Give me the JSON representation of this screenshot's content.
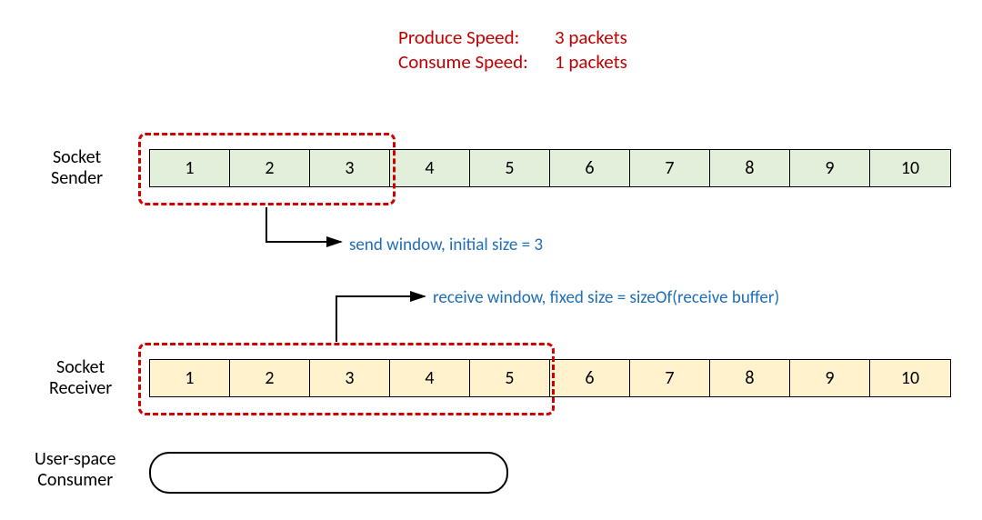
{
  "speeds": {
    "produce_label": "Produce Speed:",
    "produce_value": "3 packets",
    "consume_label": "Consume Speed:",
    "consume_value": "1 packets"
  },
  "labels": {
    "sender_l1": "Socket",
    "sender_l2": "Sender",
    "receiver_l1": "Socket",
    "receiver_l2": "Receiver",
    "consumer_l1": "User-space",
    "consumer_l2": "Consumer"
  },
  "annotations": {
    "send_window": "send window, initial size = 3",
    "receive_window": "receive window,  fixed size = sizeOf(receive buffer)"
  },
  "chart_data": {
    "type": "table",
    "sender_buffer": [
      "1",
      "2",
      "3",
      "4",
      "5",
      "6",
      "7",
      "8",
      "9",
      "10"
    ],
    "receiver_buffer": [
      "1",
      "2",
      "3",
      "4",
      "5",
      "6",
      "7",
      "8",
      "9",
      "10"
    ],
    "send_window_size": 3,
    "receive_window_size": 5,
    "sender_color": "#e2efda",
    "receiver_color": "#fff2cc",
    "window_border_color": "#d00000",
    "annotation_color": "#1f6fb8",
    "speed_color": "#c00000"
  }
}
